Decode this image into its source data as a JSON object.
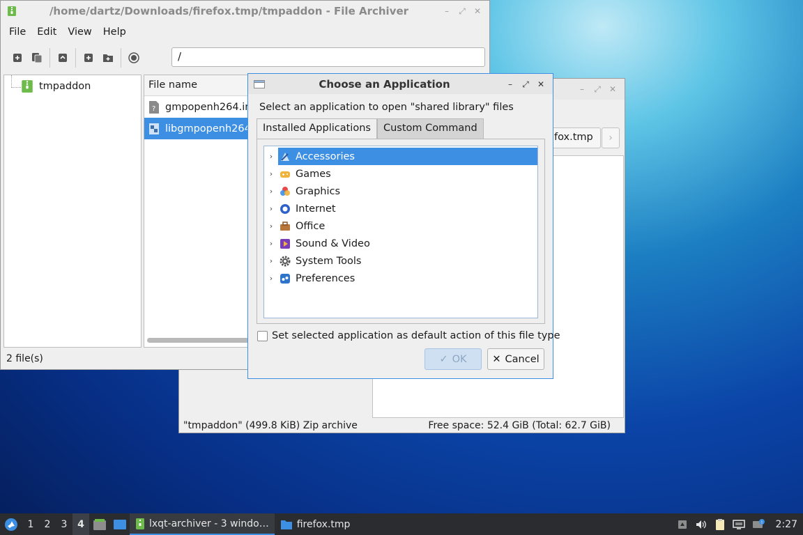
{
  "archiver": {
    "title": "/home/dartz/Downloads/firefox.tmp/tmpaddon - File Archiver",
    "menu": [
      "File",
      "Edit",
      "View",
      "Help"
    ],
    "path_value": "/",
    "tree_root": "tmpaddon",
    "list_header": "File name",
    "files": [
      "gmpopenh264.in",
      "libgmpopenh264"
    ],
    "status": "2 file(s)"
  },
  "filemanager": {
    "breadcrumb": "fox.tmp",
    "next_label": "›",
    "status_left": "\"tmpaddon\" (499.8 KiB) Zip archive",
    "status_right": "Free space: 52.4 GiB (Total: 62.7 GiB)"
  },
  "dialog": {
    "title": "Choose an Application",
    "prompt": "Select an application to open \"shared library\" files",
    "tabs": [
      "Installed Applications",
      "Custom Command"
    ],
    "categories": [
      {
        "label": "Accessories",
        "icon": "accessories-icon",
        "selected": true
      },
      {
        "label": "Games",
        "icon": "games-icon"
      },
      {
        "label": "Graphics",
        "icon": "graphics-icon"
      },
      {
        "label": "Internet",
        "icon": "internet-icon"
      },
      {
        "label": "Office",
        "icon": "office-icon"
      },
      {
        "label": "Sound & Video",
        "icon": "sound-video-icon"
      },
      {
        "label": "System Tools",
        "icon": "system-tools-icon"
      },
      {
        "label": "Preferences",
        "icon": "preferences-icon"
      }
    ],
    "default_checkbox_label": "Set selected application as default action of this file type",
    "ok_label": "OK",
    "cancel_label": "Cancel"
  },
  "taskbar": {
    "desktops": [
      "1",
      "2",
      "3",
      "4"
    ],
    "current_desktop": "4",
    "tasks": [
      "lxqt-archiver - 3 windo…",
      "firefox.tmp"
    ],
    "clock": "2:27"
  },
  "colors": {
    "accent": "#3c8fe2",
    "taskbar": "#2a2c30"
  }
}
